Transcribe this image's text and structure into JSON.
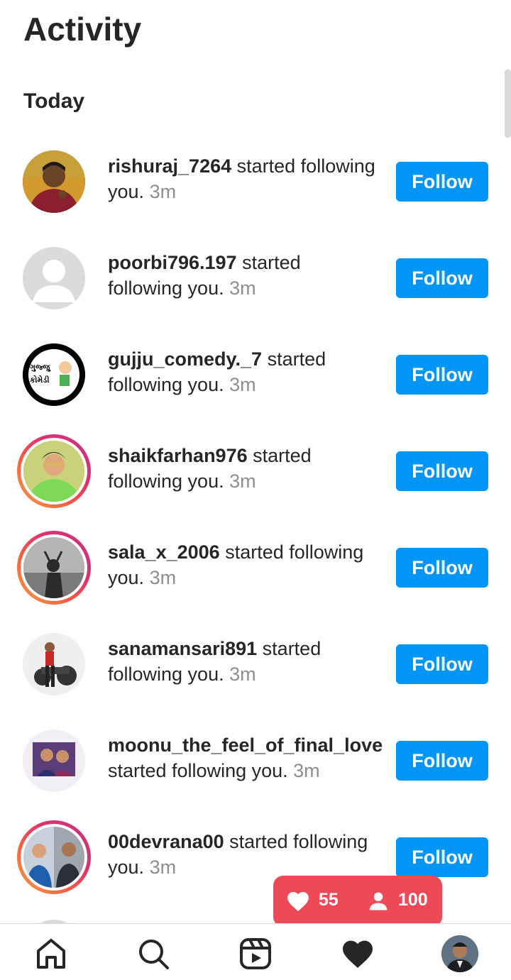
{
  "header": {
    "title": "Activity"
  },
  "section": {
    "label": "Today"
  },
  "notifications": [
    {
      "username": "rishuraj_7264",
      "action": "started following you.",
      "time": "3m",
      "button": "Follow"
    },
    {
      "username": "poorbi796.197",
      "action": "started following you.",
      "time": "3m",
      "button": "Follow"
    },
    {
      "username": "gujju_comedy._7",
      "action": "started following you.",
      "time": "3m",
      "button": "Follow"
    },
    {
      "username": "shaikfarhan976",
      "action": "started following you.",
      "time": "3m",
      "button": "Follow"
    },
    {
      "username": "sala_x_2006",
      "action": "started following you.",
      "time": "3m",
      "button": "Follow"
    },
    {
      "username": "sanamansari891",
      "action": "started following you.",
      "time": "3m",
      "button": "Follow"
    },
    {
      "username": "moonu_the_feel_of_final_love",
      "action": "started following you.",
      "time": "3m",
      "button": "Follow"
    },
    {
      "username": "00devrana00",
      "action": "started following you.",
      "time": "3m",
      "button": "Follow"
    }
  ],
  "badge_text": {
    "gujju_line1": "ગુજ્જુ",
    "gujju_line2": "કોમેડી"
  },
  "activity_bubble": {
    "likes": "55",
    "followers": "100"
  },
  "colors": {
    "follow_button": "#0095f6",
    "bubble": "#ed4956",
    "text": "#262626",
    "muted": "#8e8e8e"
  },
  "nav": {
    "items": [
      "home-icon",
      "search-icon",
      "reels-icon",
      "heart-icon",
      "profile-avatar"
    ]
  }
}
